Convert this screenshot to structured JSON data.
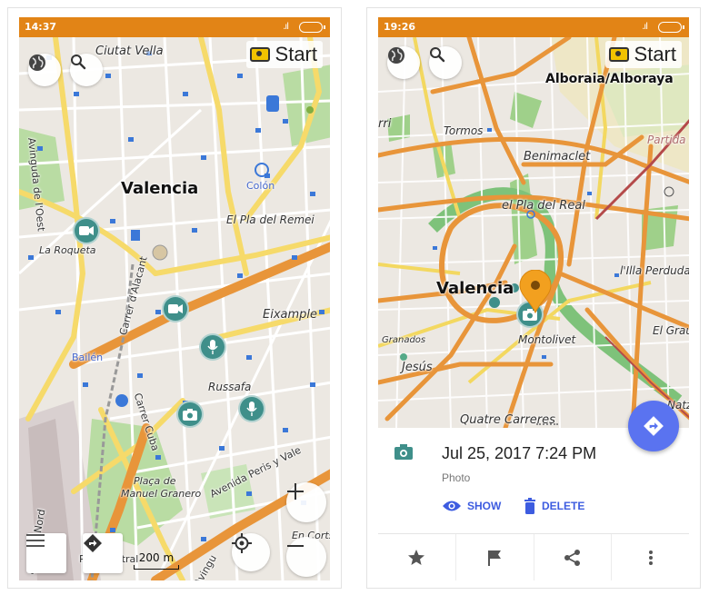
{
  "left": {
    "status": {
      "time": "14:37",
      "signal": ".ıl"
    },
    "start_label": "Start",
    "labels": {
      "ciutat_vella": "Ciutat Vella",
      "valencia": "Valencia",
      "avinguda_oest": "Avinguda de l'Oest",
      "el_pla_del_remei": "El Pla del Remei",
      "colon": "Colón",
      "la_roqueta": "La Roqueta",
      "carrer_alacant": "Carrer d'Alacant",
      "eixample": "Eixample",
      "bailen": "Bailén",
      "russafa": "Russafa",
      "carrer_cuba": "Carrer Cuba",
      "avenida_peris": "Avenida Peris y Vale",
      "placa_manuel": "Plaça de\nManuel Granero",
      "placa_line1": "Plaça de",
      "placa_line2": "Manuel Granero",
      "carrer_nord": "acio del Nord",
      "en_corts": "En Corts",
      "avinguda": "Avingu",
      "port_central": "Port Central"
    },
    "scale": "200 m"
  },
  "right": {
    "status": {
      "time": "19:26",
      "signal": ".ıl"
    },
    "start_label": "Start",
    "labels": {
      "alboraia": "Alboraia/Alboraya",
      "tormos": "Tormos",
      "benimaclet": "Benimaclet",
      "el_pla_del_real": "el Pla del Real",
      "valencia": "Valencia",
      "lilla_perduda": "l'Illa Perduda",
      "el_grau": "El Grau",
      "montolivet": "Montolivet",
      "granadors": "Granados",
      "jesus": "Jesús",
      "quatre_carreres": "Quatre Carreres",
      "partida": "Partida de",
      "nazaret": "Natz",
      "rri": "rri"
    },
    "detail": {
      "date": "Jul 25, 2017 7:24 PM",
      "type": "Photo",
      "show_label": "SHOW",
      "delete_label": "DELETE"
    }
  },
  "colors": {
    "status_bar": "#e28416",
    "teal_poi": "#3f8f8a",
    "accent_blue": "#3d5ce0",
    "fab_blue": "#5a73f0",
    "route_orange": "#e8953a",
    "pin_orange": "#f2a01f"
  },
  "icons": [
    "globe-icon",
    "search-icon",
    "camera-icon",
    "menu-icon",
    "directions-icon",
    "crosshair-icon",
    "plus-icon",
    "minus-icon",
    "video-icon",
    "mic-icon",
    "photo-icon",
    "eye-icon",
    "trash-icon",
    "star-icon",
    "flag-icon",
    "share-icon",
    "more-icon"
  ]
}
